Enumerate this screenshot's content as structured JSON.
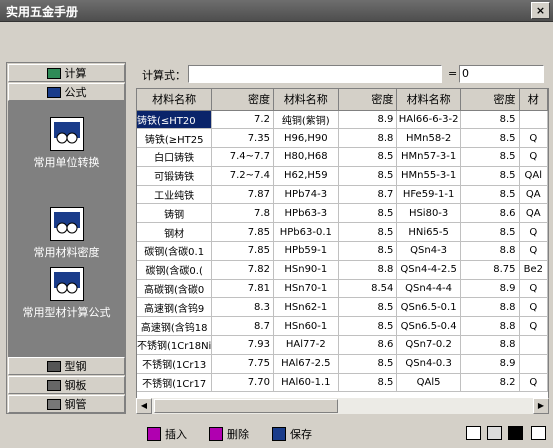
{
  "window": {
    "title": "实用五金手册",
    "close_label": "×"
  },
  "sidebar": {
    "top_buttons": [
      {
        "label": "计算"
      },
      {
        "label": "公式"
      }
    ],
    "panel_items": [
      {
        "label": "常用单位转换"
      },
      {
        "label": "常用材料密度"
      },
      {
        "label": "常用型材计算公式"
      }
    ],
    "bottom_buttons": [
      {
        "label": "型钢"
      },
      {
        "label": "钢板"
      },
      {
        "label": "钢管"
      }
    ]
  },
  "formula": {
    "label": "计算式：",
    "expression": "",
    "equals": "=",
    "result": "0"
  },
  "table": {
    "headers": [
      "材料名称",
      "密度",
      "材料名称",
      "密度",
      "材料名称",
      "密度",
      "材"
    ],
    "rows": [
      [
        "铸铁(≤HT20",
        "7.2",
        "纯铜(紫铜)",
        "8.9",
        "HAl66-6-3-2",
        "8.5",
        ""
      ],
      [
        "铸铁(≥HT25",
        "7.35",
        "H96,H90",
        "8.8",
        "HMn58-2",
        "8.5",
        "Q"
      ],
      [
        "白口铸铁",
        "7.4~7.7",
        "H80,H68",
        "8.5",
        "HMn57-3-1",
        "8.5",
        "Q"
      ],
      [
        "可锻铸铁",
        "7.2~7.4",
        "H62,H59",
        "8.5",
        "HMn55-3-1",
        "8.5",
        "QAl"
      ],
      [
        "工业纯铁",
        "7.87",
        "HPb74-3",
        "8.7",
        "HFe59-1-1",
        "8.5",
        "QA"
      ],
      [
        "铸钢",
        "7.8",
        "HPb63-3",
        "8.5",
        "HSi80-3",
        "8.6",
        "QA"
      ],
      [
        "钢材",
        "7.85",
        "HPb63-0.1",
        "8.5",
        "HNi65-5",
        "8.5",
        "Q"
      ],
      [
        "碳钢(含碳0.1",
        "7.85",
        "HPb59-1",
        "8.5",
        "QSn4-3",
        "8.8",
        "Q"
      ],
      [
        "碳钢(含碳0.(",
        "7.82",
        "HSn90-1",
        "8.8",
        "QSn4-4-2.5",
        "8.75",
        "Be2"
      ],
      [
        "高碳钢(含碳0",
        "7.81",
        "HSn70-1",
        "8.54",
        "QSn4-4-4",
        "8.9",
        "Q"
      ],
      [
        "高速钢(含钨9",
        "8.3",
        "HSn62-1",
        "8.5",
        "QSn6.5-0.1",
        "8.8",
        "Q"
      ],
      [
        "高速钢(含钨18",
        "8.7",
        "HSn60-1",
        "8.5",
        "QSn6.5-0.4",
        "8.8",
        "Q"
      ],
      [
        "不锈钢(1Cr18Ni",
        "7.93",
        "HAl77-2",
        "8.6",
        "QSn7-0.2",
        "8.8",
        ""
      ],
      [
        "不锈钢(1Cr13",
        "7.75",
        "HAl67-2.5",
        "8.5",
        "QSn4-0.3",
        "8.9",
        ""
      ],
      [
        "不锈钢(1Cr17",
        "7.70",
        "HAl60-1.1",
        "8.5",
        "QAl5",
        "8.2",
        "Q"
      ]
    ]
  },
  "scroll": {
    "left_arrow": "◀",
    "right_arrow": "▶"
  },
  "bottom_actions": [
    {
      "label": "插入"
    },
    {
      "label": "删除"
    },
    {
      "label": "保存"
    }
  ]
}
